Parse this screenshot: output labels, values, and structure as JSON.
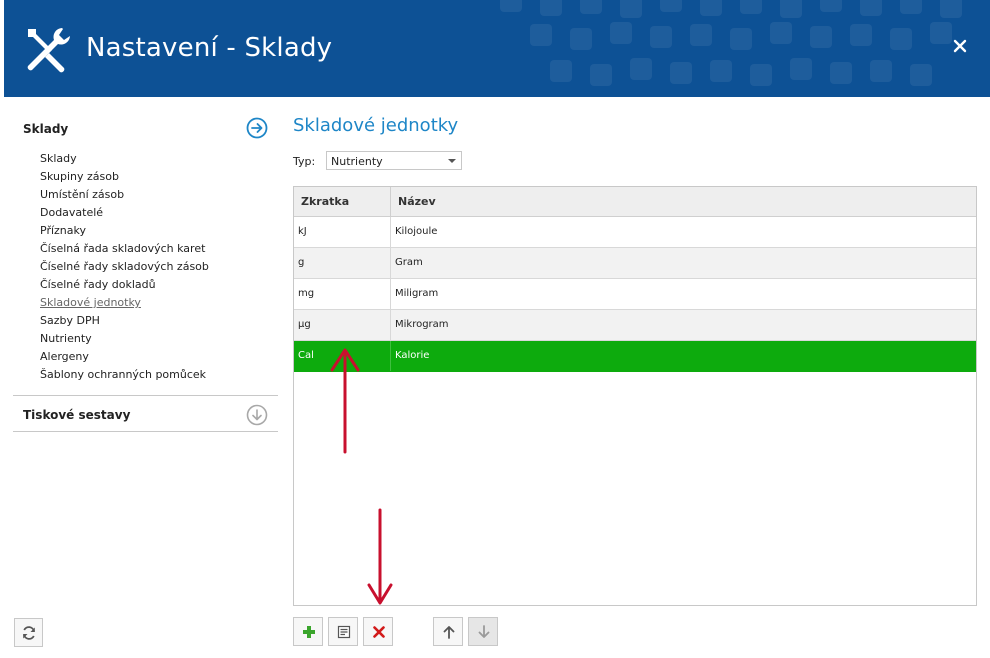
{
  "window": {
    "title": "Nastavení - Sklady",
    "close_icon": "close-icon"
  },
  "sidebar": {
    "sections": [
      {
        "title": "Sklady",
        "icon": "arrow-right-circle-icon",
        "items": [
          {
            "label": "Sklady"
          },
          {
            "label": "Skupiny zásob"
          },
          {
            "label": "Umístění zásob"
          },
          {
            "label": "Dodavatelé"
          },
          {
            "label": "Příznaky"
          },
          {
            "label": "Číselná řada skladových karet"
          },
          {
            "label": "Číselné řady skladových zásob"
          },
          {
            "label": "Číselné řady dokladů"
          },
          {
            "label": "Skladové jednotky",
            "active": true
          },
          {
            "label": "Sazby DPH"
          },
          {
            "label": "Nutrienty"
          },
          {
            "label": "Alergeny"
          },
          {
            "label": "Šablony ochranných pomůcek"
          }
        ]
      },
      {
        "title": "Tiskové sestavy",
        "icon": "arrow-down-circle-icon"
      }
    ],
    "refresh_icon": "refresh-icon"
  },
  "main": {
    "title": "Skladové jednotky",
    "filter": {
      "label": "Typ:",
      "value": "Nutrienty"
    },
    "table": {
      "columns": [
        "Zkratka",
        "Název"
      ],
      "rows": [
        {
          "abbr": "kJ",
          "name": "Kilojoule"
        },
        {
          "abbr": "g",
          "name": "Gram"
        },
        {
          "abbr": "mg",
          "name": "Miligram"
        },
        {
          "abbr": "µg",
          "name": "Mikrogram"
        },
        {
          "abbr": "Cal",
          "name": "Kalorie",
          "selected": true
        }
      ]
    },
    "toolbar": {
      "buttons": [
        {
          "icon": "add-icon"
        },
        {
          "icon": "edit-icon"
        },
        {
          "icon": "delete-icon"
        },
        {
          "icon": "move-up-icon"
        },
        {
          "icon": "move-down-icon",
          "disabled": true
        }
      ]
    }
  },
  "colors": {
    "header": "#0d5195",
    "accent": "#1e86c7",
    "selected_row": "#0dab0d",
    "annotation_arrow": "#c8102e"
  }
}
